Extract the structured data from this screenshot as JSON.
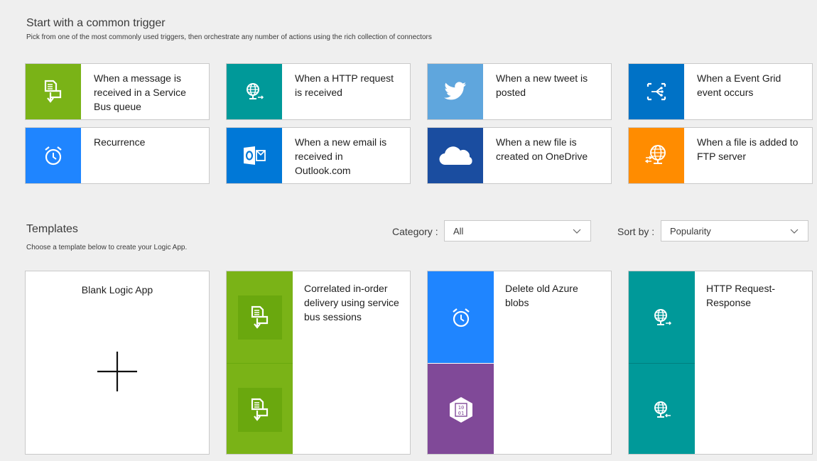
{
  "triggers_section": {
    "title": "Start with a common trigger",
    "subtitle": "Pick from one of the most commonly used triggers, then orchestrate any number of actions using the rich collection of connectors",
    "items": [
      {
        "label": "When a message is received in a Service Bus queue",
        "icon": "service-bus-icon",
        "color": "#7ab317"
      },
      {
        "label": "When a HTTP request is received",
        "icon": "http-request-icon",
        "color": "#009999"
      },
      {
        "label": "When a new tweet is posted",
        "icon": "twitter-icon",
        "color": "#5fa6dd"
      },
      {
        "label": "When a Event Grid event occurs",
        "icon": "event-grid-icon",
        "color": "#0072c6"
      },
      {
        "label": "Recurrence",
        "icon": "alarm-clock-icon",
        "color": "#1f85ff"
      },
      {
        "label": "When a new email is received in Outlook.com",
        "icon": "outlook-icon",
        "color": "#0078d7"
      },
      {
        "label": "When a new file is created on OneDrive",
        "icon": "onedrive-icon",
        "color": "#1a4da0"
      },
      {
        "label": "When a file is added to FTP server",
        "icon": "ftp-icon",
        "color": "#ff8c00"
      }
    ]
  },
  "templates_section": {
    "title": "Templates",
    "subtitle": "Choose a template below to create your Logic App.",
    "category": {
      "label": "Category :",
      "value": "All"
    },
    "sort": {
      "label": "Sort by :",
      "value": "Popularity"
    },
    "items": [
      {
        "label": "Blank Logic App",
        "icon": "plus-icon"
      },
      {
        "label": "Correlated in-order delivery using service bus sessions",
        "icons": [
          "service-bus-icon",
          "service-bus-icon"
        ],
        "colors": [
          "#7ab317",
          "#7ab317"
        ]
      },
      {
        "label": "Delete old Azure blobs",
        "icons": [
          "alarm-clock-icon",
          "blob-storage-icon"
        ],
        "colors": [
          "#1f85ff",
          "#804998"
        ]
      },
      {
        "label": "HTTP Request-Response",
        "icons": [
          "http-request-icon",
          "http-response-icon"
        ],
        "colors": [
          "#009999",
          "#009999"
        ]
      }
    ]
  }
}
